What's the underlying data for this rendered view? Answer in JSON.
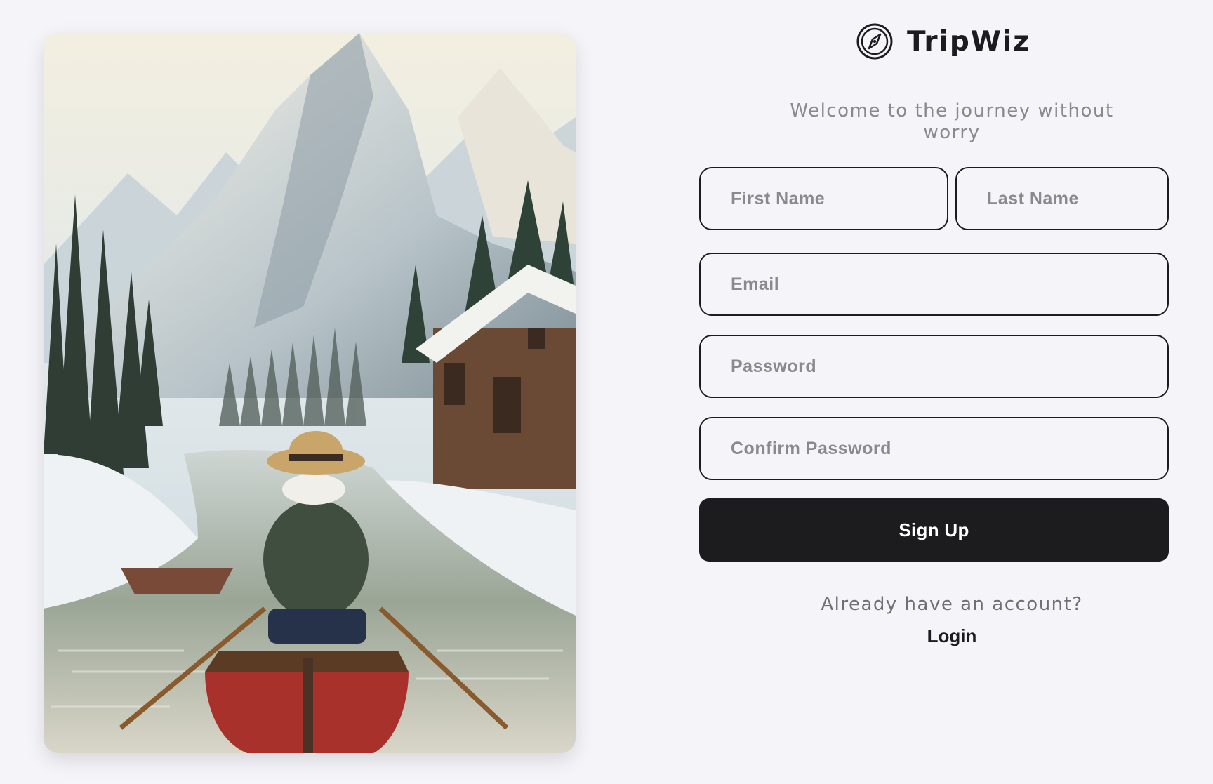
{
  "brand": {
    "name": "TripWiz",
    "icon": "compass-icon"
  },
  "tagline": "Welcome to the journey without worry",
  "form": {
    "first_name": {
      "placeholder": "First Name",
      "value": ""
    },
    "last_name": {
      "placeholder": "Last Name",
      "value": ""
    },
    "email": {
      "placeholder": "Email",
      "value": ""
    },
    "password": {
      "placeholder": "Password",
      "value": ""
    },
    "confirm_password": {
      "placeholder": "Confirm Password",
      "value": ""
    },
    "submit_label": "Sign Up"
  },
  "footer": {
    "prompt": "Already have an account?",
    "login_label": "Login"
  },
  "colors": {
    "background": "#f4f4f9",
    "primary": "#1c1c1e",
    "muted_text": "#8a8a8d"
  }
}
